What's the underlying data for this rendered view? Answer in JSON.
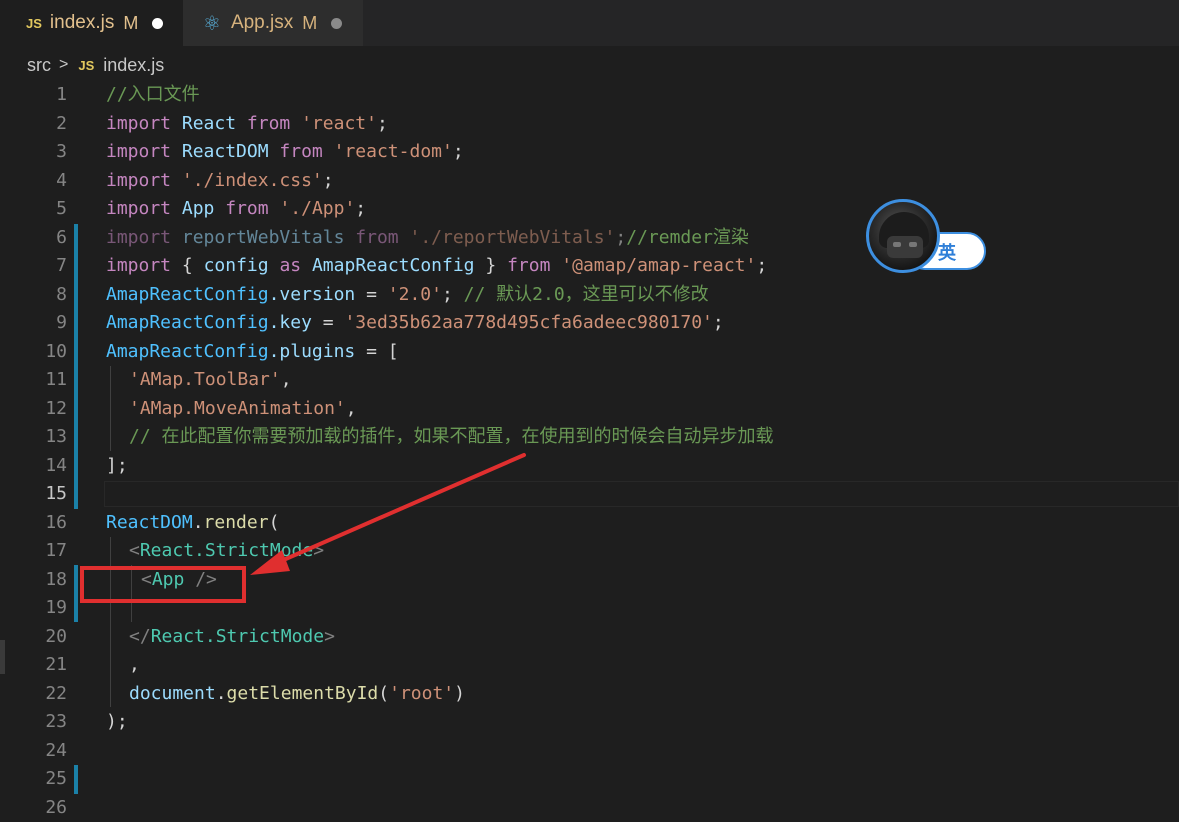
{
  "tabs": [
    {
      "icon": "JS",
      "name": "index.js",
      "modified": "M",
      "active": true
    },
    {
      "icon": "react-icon",
      "name": "App.jsx",
      "modified": "M",
      "active": false
    }
  ],
  "breadcrumb": {
    "folder": "src",
    "file_icon": "JS",
    "file": "index.js"
  },
  "line_numbers": [
    "1",
    "2",
    "3",
    "4",
    "5",
    "6",
    "7",
    "8",
    "9",
    "10",
    "11",
    "12",
    "13",
    "14",
    "15",
    "16",
    "17",
    "18",
    "19",
    "20",
    "21",
    "22",
    "23",
    "24",
    "25",
    "26"
  ],
  "current_line": "15",
  "code": {
    "l1": {
      "comment": "//入口文件"
    },
    "l2": {
      "import": "import",
      "name": "React",
      "from": "from",
      "str": "'react'",
      "semi": ";"
    },
    "l3": {
      "import": "import",
      "name": "ReactDOM",
      "from": "from",
      "str": "'react-dom'",
      "semi": ";"
    },
    "l4": {
      "import": "import",
      "str": "'./index.css'",
      "semi": ";"
    },
    "l5": {
      "import": "import",
      "name": "App",
      "from": "from",
      "str": "'./App'",
      "semi": ";"
    },
    "l6": {
      "import": "import",
      "name": "reportWebVitals",
      "from": "from",
      "str": "'./reportWebVitals'",
      "semi": ";",
      "comment": "//remder渲染"
    },
    "l7": {
      "import": "import",
      "open": "{ ",
      "name": "config",
      "as": "as",
      "alias": "AmapReactConfig",
      "close": " }",
      "from": "from",
      "str": "'@amap/amap-react'",
      "semi": ";"
    },
    "l8": {
      "obj": "AmapReactConfig",
      "prop": ".version",
      "eq": " = ",
      "str": "'2.0'",
      "semi": ";",
      "comment": "// 默认2.0，这里可以不修改"
    },
    "l9": {
      "obj": "AmapReactConfig",
      "prop": ".key",
      "eq": " = ",
      "str": "'3ed35b62aa778d495cfa6adeec980170'",
      "semi": ";"
    },
    "l10": {
      "obj": "AmapReactConfig",
      "prop": ".plugins",
      "eq": " = ["
    },
    "l11": {
      "str": "'AMap.ToolBar'",
      "comma": ","
    },
    "l12": {
      "str": "'AMap.MoveAnimation'",
      "comma": ","
    },
    "l13": {
      "comment": "// 在此配置你需要预加载的插件，如果不配置，在使用到的时候会自动异步加载"
    },
    "l14": {
      "text": "];"
    },
    "l16": {
      "obj": "ReactDOM",
      "fn": "render",
      "open": "("
    },
    "l17": {
      "lt": "<",
      "tag": "React.StrictMode",
      "gt": ">"
    },
    "l18": {
      "lt": "<",
      "tag": "App",
      "gt": " />"
    },
    "l20": {
      "lt": "</",
      "tag": "React.StrictMode",
      "gt": ">"
    },
    "l21": {
      "text": ","
    },
    "l22": {
      "obj": "document",
      "fn": "getElementById",
      "open": "(",
      "str": "'root'",
      "close": ")"
    },
    "l23": {
      "text": ");"
    }
  },
  "ime_indicator": {
    "label": "英"
  },
  "colors": {
    "keyword": "#c586c0",
    "variable": "#9cdcfe",
    "string": "#ce9178",
    "comment": "#6a9955",
    "tag": "#4ec9b0",
    "function": "#dcdcaa",
    "annotation": "#e02f2f",
    "background": "#1e1e1e"
  }
}
